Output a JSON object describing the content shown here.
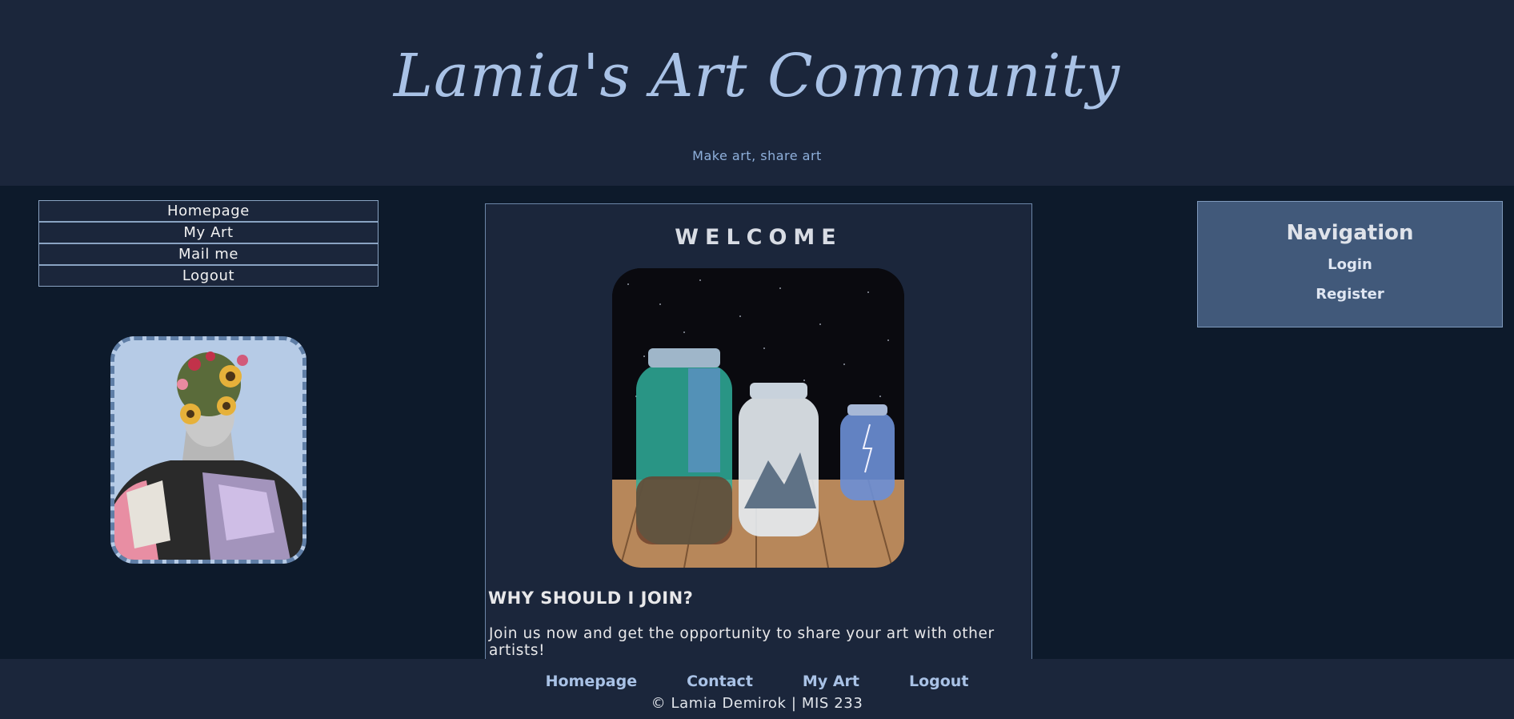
{
  "header": {
    "title": "Lamia's Art Community",
    "tagline": "Make art, share art"
  },
  "side_menu": {
    "items": [
      {
        "label": "Homepage"
      },
      {
        "label": "My Art"
      },
      {
        "label": "Mail me"
      },
      {
        "label": "Logout"
      }
    ]
  },
  "main": {
    "heading": "WELCOME",
    "subheading": "WHY SHOULD I JOIN?",
    "body": "Join us now and get the opportunity to share your art with other artists!"
  },
  "navigation": {
    "title": "Navigation",
    "links": [
      {
        "label": "Login"
      },
      {
        "label": "Register"
      }
    ]
  },
  "footer": {
    "links": [
      {
        "label": "Homepage"
      },
      {
        "label": "Contact"
      },
      {
        "label": "My Art"
      },
      {
        "label": "Logout"
      }
    ],
    "copyright": "© Lamia Demirok | MIS 233"
  },
  "colors": {
    "header_bg": "#1b263b",
    "page_bg": "#0d1a2b",
    "accent": "#a9c2e6",
    "nav_box_bg": "#41597a"
  }
}
